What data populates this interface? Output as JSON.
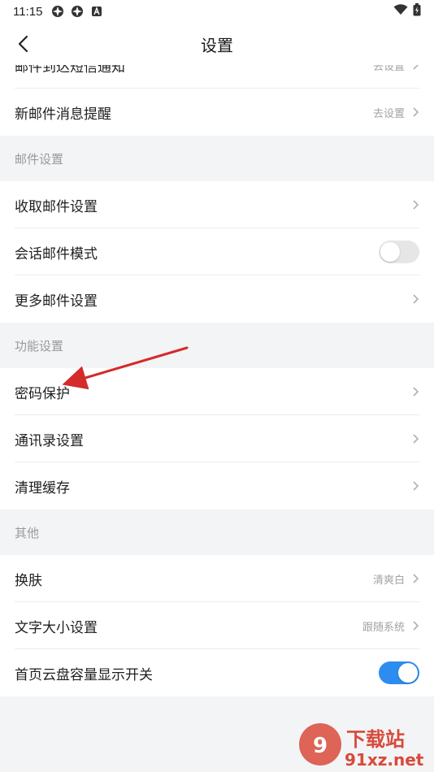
{
  "status_bar": {
    "time": "11:15"
  },
  "header": {
    "title": "设置"
  },
  "rows_top": [
    {
      "label": "邮件到达短信通知",
      "value": "去设置"
    },
    {
      "label": "新邮件消息提醒",
      "value": "去设置"
    }
  ],
  "section_mail": {
    "title": "邮件设置",
    "receive_label": "收取邮件设置",
    "conversation_label": "会话邮件模式",
    "conversation_enabled": false,
    "more_label": "更多邮件设置"
  },
  "section_function": {
    "title": "功能设置",
    "password_label": "密码保护",
    "contacts_label": "通讯录设置",
    "cache_label": "清理缓存"
  },
  "section_other": {
    "title": "其他",
    "skin_label": "换肤",
    "skin_value": "清爽白",
    "font_label": "文字大小设置",
    "font_value": "跟随系统",
    "cloud_label": "首页云盘容量显示开关",
    "cloud_enabled": true
  },
  "watermark": {
    "text_cn": "下载站",
    "text_en": "91xz.net"
  },
  "colors": {
    "accent": "#2d8cf0",
    "arrow": "#d42a2a",
    "page_bg": "#f3f4f6"
  }
}
